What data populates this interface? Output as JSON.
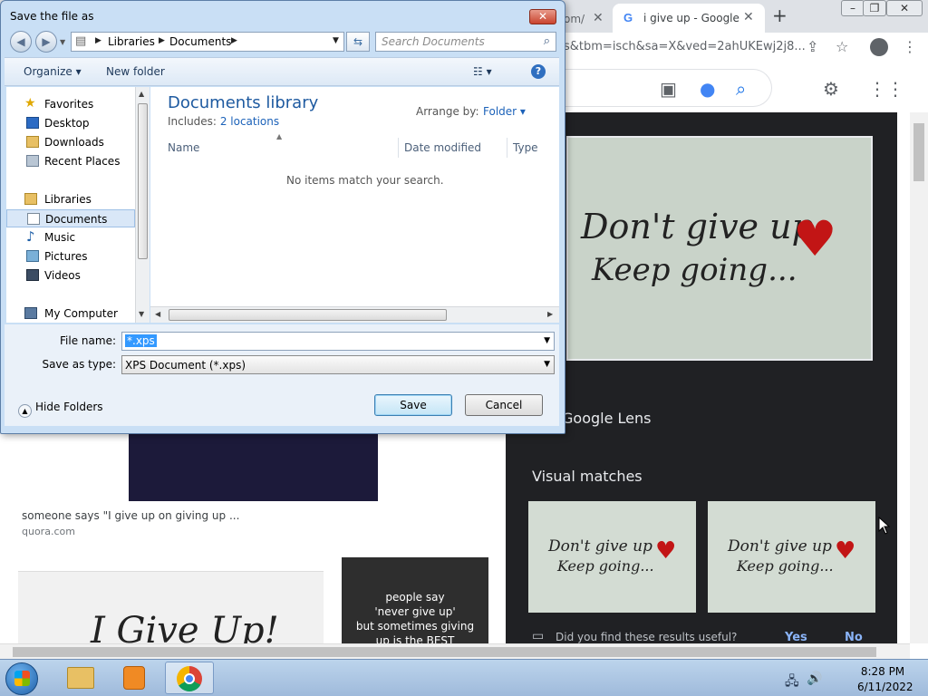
{
  "browser": {
    "partial_tab_text": "om/",
    "active_tab_title": "i give up - Google",
    "url": "s&tbm=isch&sa=X&ved=2ahUKEwj2j8...",
    "new_tab_symbol": "+"
  },
  "results": {
    "caption": "someone says \"I give up on giving up ...",
    "source": "quora.com",
    "paper_text": "I Give Up!",
    "quote_text": [
      "people say",
      "'never give up'",
      "but sometimes giving",
      "up is the BEST"
    ]
  },
  "lens": {
    "image_line1": "Don't give up",
    "image_line2": "Keep going...",
    "title": "Google Lens",
    "visual_matches_title": "Visual matches",
    "match_line1": "Don't give up",
    "match_line2": "Keep going...",
    "feedback_question": "Did you find these results useful?",
    "yes": "Yes",
    "no": "No"
  },
  "dialog": {
    "title": "Save the file as",
    "close_symbol": "✕",
    "breadcrumb": [
      "Libraries",
      "Documents"
    ],
    "search_placeholder": "Search Documents",
    "organize": "Organize ▾",
    "new_folder": "New folder",
    "nav": {
      "favorites": "Favorites",
      "desktop": "Desktop",
      "downloads": "Downloads",
      "recent_places": "Recent Places",
      "libraries": "Libraries",
      "documents": "Documents",
      "music": "Music",
      "pictures": "Pictures",
      "videos": "Videos",
      "my_computer": "My Computer"
    },
    "library_title": "Documents library",
    "includes_label": "Includes:",
    "includes_link": "2 locations",
    "arrange_label": "Arrange by:",
    "arrange_value": "Folder ▾",
    "columns": [
      "Name",
      "Date modified",
      "Type"
    ],
    "empty_message": "No items match your search.",
    "file_name_label": "File name:",
    "file_name_value": "*.xps",
    "save_type_label": "Save as type:",
    "save_type_value": "XPS Document (*.xps)",
    "hide_folders": "Hide Folders",
    "save": "Save",
    "cancel": "Cancel"
  },
  "taskbar": {
    "time": "8:28 PM",
    "date": "6/11/2022"
  }
}
